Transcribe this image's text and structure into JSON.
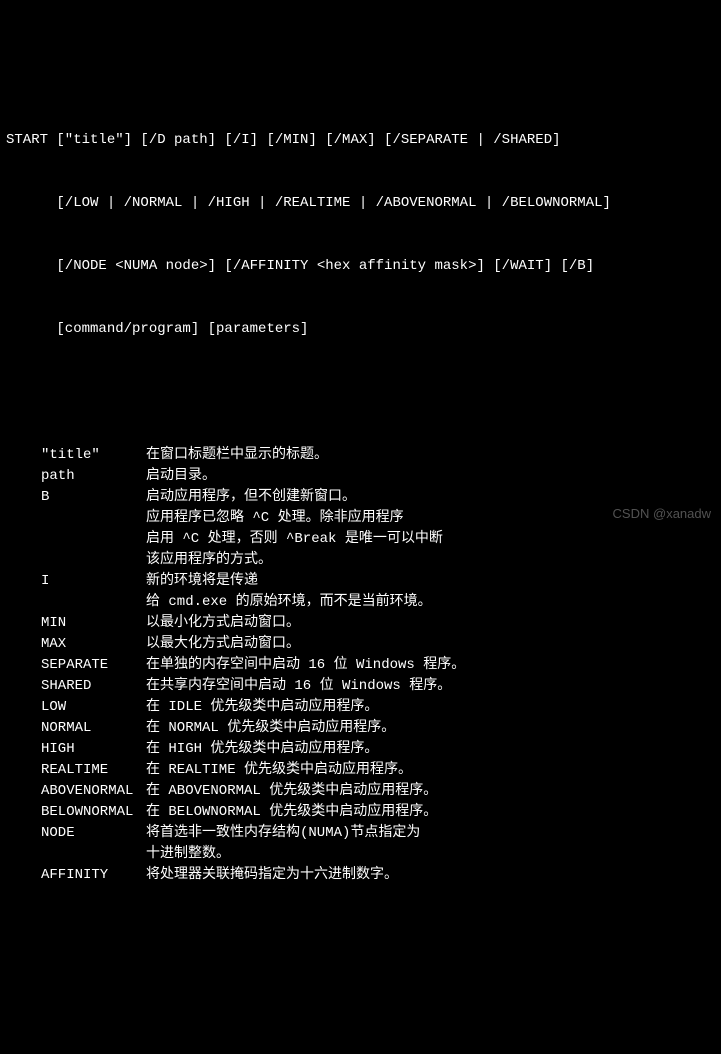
{
  "syntax": {
    "line1": "START [\"title\"] [/D path] [/I] [/MIN] [/MAX] [/SEPARATE | /SHARED]",
    "line2": "      [/LOW | /NORMAL | /HIGH | /REALTIME | /ABOVENORMAL | /BELOWNORMAL]",
    "line3": "      [/NODE <NUMA node>] [/AFFINITY <hex affinity mask>] [/WAIT] [/B]",
    "line4": "      [command/program] [parameters]"
  },
  "params": [
    {
      "key": "\"title\"",
      "desc": "在窗口标题栏中显示的标题。"
    },
    {
      "key": "path",
      "desc": "启动目录。"
    },
    {
      "key": "B",
      "desc": "启动应用程序，但不创建新窗口。"
    },
    {
      "key": "",
      "desc": "应用程序已忽略 ^C 处理。除非应用程序"
    },
    {
      "key": "",
      "desc": "启用 ^C 处理，否则 ^Break 是唯一可以中断"
    },
    {
      "key": "",
      "desc": "该应用程序的方式。"
    },
    {
      "key": "I",
      "desc": "新的环境将是传递"
    },
    {
      "key": "",
      "desc": "给 cmd.exe 的原始环境，而不是当前环境。"
    },
    {
      "key": "MIN",
      "desc": "以最小化方式启动窗口。"
    },
    {
      "key": "MAX",
      "desc": "以最大化方式启动窗口。"
    },
    {
      "key": "SEPARATE",
      "desc": "在单独的内存空间中启动 16 位 Windows 程序。"
    },
    {
      "key": "SHARED",
      "desc": "在共享内存空间中启动 16 位 Windows 程序。"
    },
    {
      "key": "LOW",
      "desc": "在 IDLE 优先级类中启动应用程序。"
    },
    {
      "key": "NORMAL",
      "desc": "在 NORMAL 优先级类中启动应用程序。"
    },
    {
      "key": "HIGH",
      "desc": "在 HIGH 优先级类中启动应用程序。"
    },
    {
      "key": "REALTIME",
      "desc": "在 REALTIME 优先级类中启动应用程序。"
    },
    {
      "key": "ABOVENORMAL",
      "desc": "在 ABOVENORMAL 优先级类中启动应用程序。"
    },
    {
      "key": "BELOWNORMAL",
      "desc": "在 BELOWNORMAL 优先级类中启动应用程序。"
    },
    {
      "key": "NODE",
      "desc": "将首选非一致性内存结构(NUMA)节点指定为"
    },
    {
      "key": "",
      "desc": "十进制整数。"
    },
    {
      "key": "AFFINITY",
      "desc": "将处理器关联掩码指定为十六进制数字。"
    }
  ],
  "watermark": "CSDN @xanadw"
}
